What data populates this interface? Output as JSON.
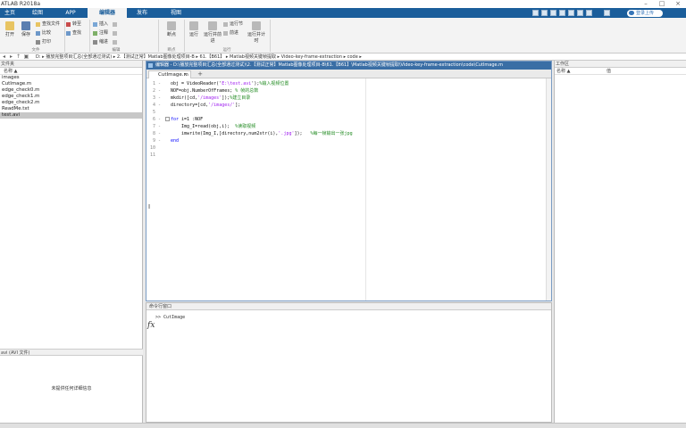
{
  "window": {
    "title": "ATLAB R2018a"
  },
  "tabs": [
    {
      "label": "主页"
    },
    {
      "label": "绘图"
    },
    {
      "label": "APP"
    },
    {
      "label": "编辑器"
    },
    {
      "label": "发布"
    },
    {
      "label": "视图"
    }
  ],
  "search": {
    "label": "登录上传"
  },
  "ribbon": {
    "open": "打开",
    "save": "保存",
    "find_files": "查找文件",
    "compare": "比较",
    "print": "打印",
    "insert": "插入",
    "comment": "注释",
    "indent": "缩进",
    "go_to": "转至",
    "find": "查找",
    "breakpoint": "断点",
    "run": "运行",
    "run_and_advance": "运行并前进",
    "run_section": "运行节",
    "advance": "前进",
    "run_and_time": "运行并计时",
    "groups": {
      "file": "文件",
      "edit": "编辑",
      "breakpoints": "断点",
      "run": "运行"
    }
  },
  "path": {
    "drive": "D:",
    "segments": [
      "播放完整项目汇总(全部通过测试)",
      "2.【测试正常】Matlab图像处理项目-B",
      "61.【B61】",
      "Matlab视频关键帧提取",
      "Video-key-frame-extraction",
      "code"
    ]
  },
  "left_panel": {
    "title": "文件夹",
    "column": "名称 ▲",
    "files": [
      {
        "name": "images",
        "selected": false
      },
      {
        "name": "CutImage.m",
        "selected": false
      },
      {
        "name": "edge_check0.m",
        "selected": false
      },
      {
        "name": "edge_check1.m",
        "selected": false
      },
      {
        "name": "edge_check2.m",
        "selected": false
      },
      {
        "name": "ReadMe.txt",
        "selected": false
      },
      {
        "name": "test.avi",
        "selected": true
      }
    ],
    "details_title": "avi  (AVI 文件)",
    "details_text": "未提供任何详细信息"
  },
  "editor": {
    "title": "编辑器 - D:\\播放完整项目汇总(全部通过测试)\\2.【测试正常】Matlab图像处理项目-B\\61.【B61】\\Matlab视频关键帧提取\\Video-key-frame-extraction\\code\\CutImage.m",
    "tab": "CutImage.m",
    "add_tab": "+",
    "lines": [
      {
        "n": "1",
        "dash": "-",
        "parts": [
          [
            "",
            "obj = VideoReader('"
          ],
          [
            "str",
            "E:\\test.avi"
          ],
          [
            "",
            "');"
          ],
          [
            "cm",
            "%输入视频位置"
          ]
        ]
      },
      {
        "n": "2",
        "dash": "-",
        "parts": [
          [
            "",
            "NOF=obj.NumberOfFrames; "
          ],
          [
            "cm",
            "% 帧的总数"
          ]
        ]
      },
      {
        "n": "3",
        "dash": "-",
        "parts": [
          [
            "",
            "mkdir([cd,"
          ],
          [
            "str",
            "'/images'"
          ],
          [
            "",
            "]);"
          ],
          [
            "cm",
            "%建立目录"
          ]
        ]
      },
      {
        "n": "4",
        "dash": "-",
        "parts": [
          [
            "",
            "directory=[cd,"
          ],
          [
            "str",
            "'/images/'"
          ],
          [
            "",
            "];"
          ]
        ]
      },
      {
        "n": "5",
        "dash": "",
        "parts": []
      },
      {
        "n": "6",
        "dash": "-",
        "parts": [
          [
            "kw",
            "for"
          ],
          [
            "",
            " i=1 :NOF"
          ]
        ]
      },
      {
        "n": "7",
        "dash": "-",
        "parts": [
          [
            "",
            "    Img_I=read(obj,i);  "
          ],
          [
            "cm",
            "%读取视频"
          ]
        ]
      },
      {
        "n": "8",
        "dash": "-",
        "parts": [
          [
            "",
            "    imwrite(Img_I,[directory,num2str(i),"
          ],
          [
            "str",
            "'.jpg'"
          ],
          [
            "",
            "]);   "
          ],
          [
            "cm",
            "%每一帧输出一张jpg"
          ]
        ]
      },
      {
        "n": "9",
        "dash": "-",
        "parts": [
          [
            "kw",
            "end"
          ]
        ]
      },
      {
        "n": "10",
        "dash": "",
        "parts": []
      },
      {
        "n": "11",
        "dash": "",
        "parts": []
      }
    ]
  },
  "command_window": {
    "title": "命令行窗口",
    "prompt": ">> CutImage",
    "fx": "fx"
  },
  "workspace": {
    "title": "工作区",
    "col_name": "名称 ▲",
    "col_value": "值"
  }
}
